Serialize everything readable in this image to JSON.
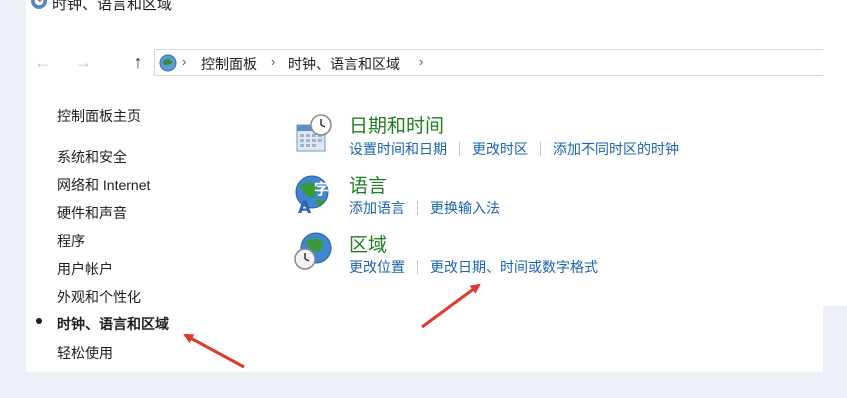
{
  "window": {
    "title": "时钟、语言和区域"
  },
  "nav": {
    "back_icon": "arrow-left-icon",
    "forward_icon": "arrow-right-icon",
    "up_icon": "arrow-up-icon",
    "breadcrumb": [
      "控制面板",
      "时钟、语言和区域"
    ]
  },
  "sidebar": {
    "home": "控制面板主页",
    "items": [
      "系统和安全",
      "网络和 Internet",
      "硬件和声音",
      "程序",
      "用户帐户",
      "外观和个性化",
      "时钟、语言和区域",
      "轻松使用"
    ],
    "current_index": 6
  },
  "categories": [
    {
      "title": "日期和时间",
      "icon": "calendar-clock-icon",
      "links": [
        "设置时间和日期",
        "更改时区",
        "添加不同时区的时钟"
      ]
    },
    {
      "title": "语言",
      "icon": "globe-language-icon",
      "links": [
        "添加语言",
        "更换输入法"
      ]
    },
    {
      "title": "区域",
      "icon": "globe-clock-icon",
      "links": [
        "更改位置",
        "更改日期、时间或数字格式"
      ]
    }
  ],
  "colors": {
    "category_title": "#1e7f1e",
    "link": "#1a64b0",
    "annotation_arrow": "#e03a2e",
    "page_background": "#eef0f8"
  }
}
